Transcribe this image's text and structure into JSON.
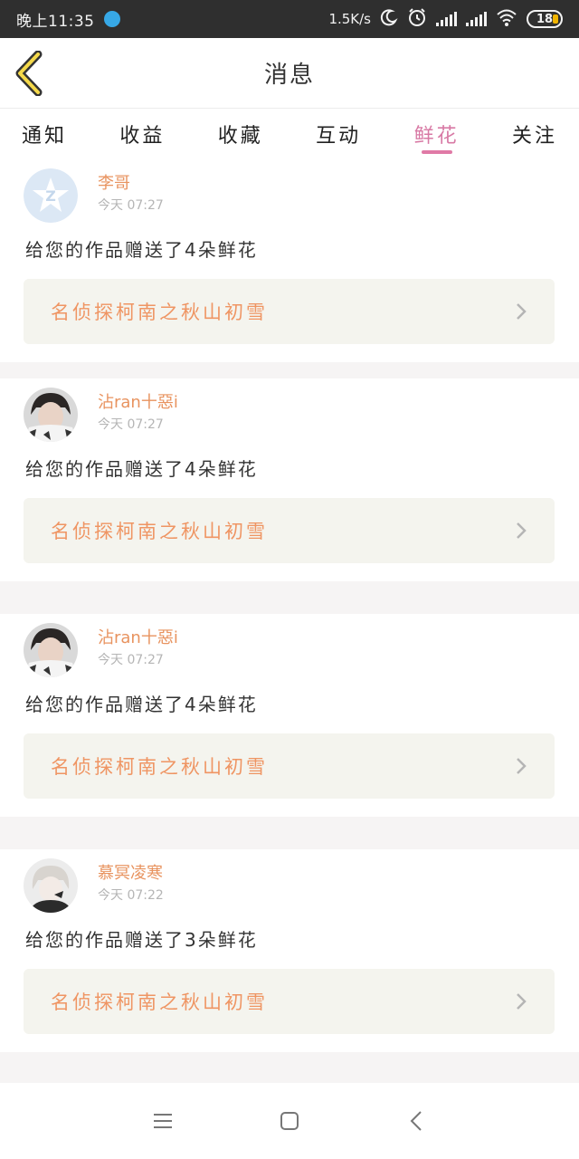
{
  "status_bar": {
    "time": "晚上11:35",
    "net_speed": "1.5K/s",
    "battery": "18"
  },
  "header": {
    "title": "消息"
  },
  "tabs": [
    {
      "label": "通知"
    },
    {
      "label": "收益"
    },
    {
      "label": "收藏"
    },
    {
      "label": "互动"
    },
    {
      "label": "鲜花",
      "active": true
    },
    {
      "label": "关注"
    }
  ],
  "notifications": [
    {
      "username": "李哥",
      "time": "今天 07:27",
      "message": "给您的作品赠送了4朵鲜花",
      "work_title": "名侦探柯南之秋山初雪",
      "avatar": "default-z-avatar"
    },
    {
      "username": "沾ran十惡i",
      "time": "今天 07:27",
      "message": "给您的作品赠送了4朵鲜花",
      "work_title": "名侦探柯南之秋山初雪",
      "avatar": "user-photo-avatar"
    },
    {
      "username": "沾ran十惡i",
      "time": "今天 07:27",
      "message": "给您的作品赠送了4朵鲜花",
      "work_title": "名侦探柯南之秋山初雪",
      "avatar": "user-photo-avatar"
    },
    {
      "username": "慕冥凌寒",
      "time": "今天 07:22",
      "message": "给您的作品赠送了3朵鲜花",
      "work_title": "名侦探柯南之秋山初雪",
      "avatar": "anime-photo-avatar"
    }
  ],
  "colors": {
    "accent_pink": "#e07aa6",
    "username_orange": "#e8935f",
    "work_title_orange": "#ef9563"
  }
}
